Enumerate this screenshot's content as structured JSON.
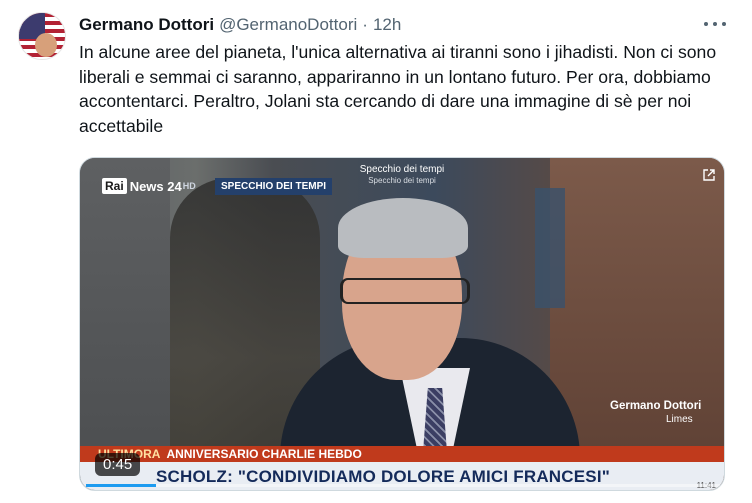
{
  "tweet": {
    "author_name": "Germano Dottori",
    "handle": "@GermanoDottori",
    "separator": "·",
    "time": "12h",
    "text": "In alcune aree del pianeta, l'unica alternativa ai tiranni sono i jihadisti. Non ci sono liberali e semmai ci saranno, appariranno in un lontano futuro. Per ora, dobbiamo accontentarci. Peraltro, Jolani sta cercando di dare una immagine di sè per noi accettabile"
  },
  "video": {
    "channel": "Rai",
    "channel_suffix": "News 24",
    "channel_hd": "HD",
    "program_tag": "SPECCHIO DEI TEMPI",
    "program_title": "Specchio dei tempi",
    "program_subtitle": "Specchio dei tempi",
    "guest_name": "Germano Dottori",
    "guest_org": "Limes",
    "ticker_label": "ULTIMORA",
    "ticker_headline": "ANNIVERSARIO CHARLIE HEBDO",
    "caption": "SCHOLZ: \"CONDIVIDIAMO DOLORE AMICI FRANCESI\"",
    "clock": "11:41",
    "timer": "0:45",
    "progress_fraction": 0.11
  },
  "icons": {
    "more": "more-icon",
    "share": "share-icon"
  },
  "colors": {
    "accent": "#1d9bf0",
    "ticker_red": "#c03a1c",
    "caption_blue": "#142a5a"
  }
}
